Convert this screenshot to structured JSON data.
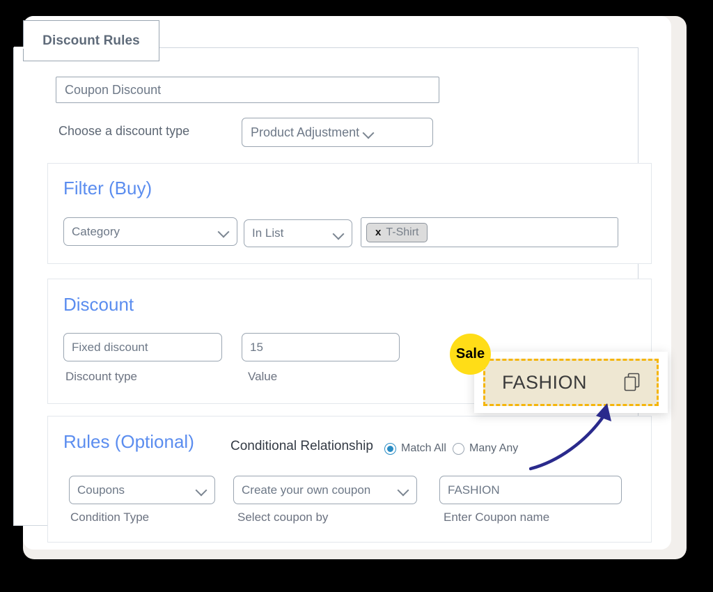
{
  "tab": {
    "label": "Discount Rules"
  },
  "coupon_name": {
    "value": "Coupon Discount",
    "placeholder": "Coupon Discount"
  },
  "discount_type_row": {
    "label": "Choose a discount type",
    "selected": "Product Adjustment",
    "chevron_icon": "chevron-down-icon"
  },
  "filter": {
    "title": "Filter (Buy)",
    "field": "Category",
    "operator": "In List",
    "chips": [
      {
        "remove_icon": "x-icon",
        "remove_label": "x",
        "label": "T-Shirt"
      }
    ]
  },
  "discount": {
    "title": "Discount",
    "type_value": "Fixed discount",
    "type_caption": "Discount type",
    "value_value": "15",
    "value_caption": "Value"
  },
  "rules": {
    "title": "Rules (Optional)",
    "conditional_label": "Conditional Relationship",
    "radios": [
      {
        "label": "Match All",
        "selected": true
      },
      {
        "label": "Many Any",
        "selected": false
      }
    ],
    "condition_type_value": "Coupons",
    "condition_type_caption": "Condition Type",
    "select_coupon_value": "Create your own coupon",
    "select_coupon_caption": "Select coupon by",
    "coupon_name_value": "FASHION",
    "coupon_name_caption": "Enter Coupon name"
  },
  "callout": {
    "badge_label": "Sale",
    "coupon_code": "FASHION",
    "copy_icon": "copy-icon",
    "arrow_icon": "curved-arrow-icon"
  },
  "colors": {
    "background": "#000000",
    "card": "#ffffff",
    "frame": "#f2efec",
    "section_heading": "#5b8def",
    "tab_text": "#5f6b7a",
    "border": "#9aa5b1",
    "section_border": "#e3e7ec",
    "radio_accent": "#2a8cc4",
    "badge_yellow": "#ffdd17",
    "chip_dash": "#f5b50a",
    "chip_fill": "#eee7d2",
    "arrow": "#2a2a8c"
  }
}
